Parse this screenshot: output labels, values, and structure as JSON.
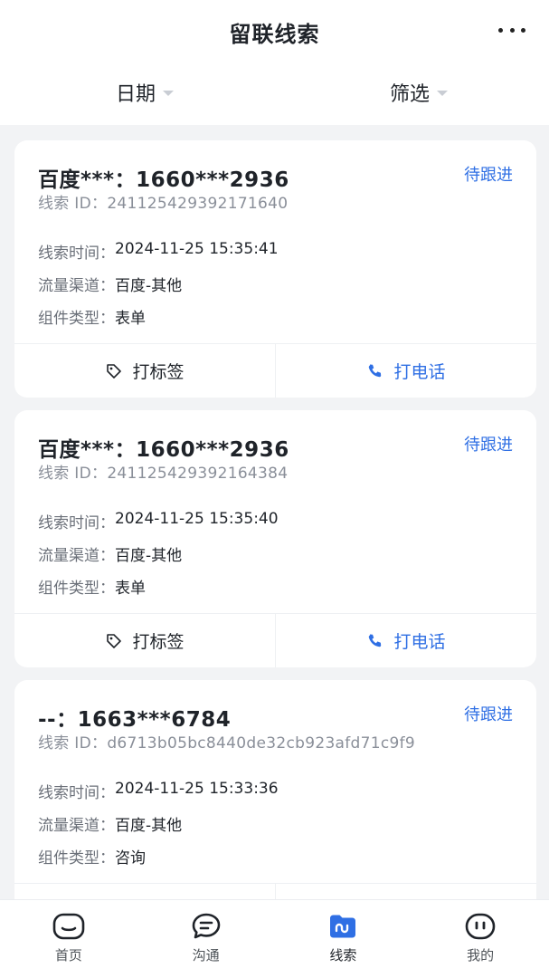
{
  "header": {
    "title": "留联线索"
  },
  "filters": {
    "date_label": "日期",
    "screen_label": "筛选"
  },
  "labels": {
    "time_key": "线索时间：",
    "channel_key": "流量渠道：",
    "component_key": "组件类型：",
    "id_prefix": "线索 ID：",
    "tag_action": "打标签",
    "call_action": "打电话"
  },
  "cards": [
    {
      "title": "百度***：1660***2936",
      "status": "待跟进",
      "lead_id": "241125429392171640",
      "time": "2024-11-25 15:35:41",
      "channel": "百度-其他",
      "component": "表单"
    },
    {
      "title": "百度***：1660***2936",
      "status": "待跟进",
      "lead_id": "241125429392164384",
      "time": "2024-11-25 15:35:40",
      "channel": "百度-其他",
      "component": "表单"
    },
    {
      "title": "--：1663***6784",
      "status": "待跟进",
      "lead_id": "d6713b05bc8440de32cb923afd71c9f9",
      "time": "2024-11-25 15:33:36",
      "channel": "百度-其他",
      "component": "咨询"
    }
  ],
  "tabs": [
    {
      "label": "首页",
      "icon": "home-icon"
    },
    {
      "label": "沟通",
      "icon": "chat-icon"
    },
    {
      "label": "线索",
      "icon": "leads-icon",
      "active": true
    },
    {
      "label": "我的",
      "icon": "profile-icon"
    }
  ],
  "colors": {
    "accent": "#2f6fe4",
    "background": "#f2f3f5",
    "text": "#1f2329"
  }
}
